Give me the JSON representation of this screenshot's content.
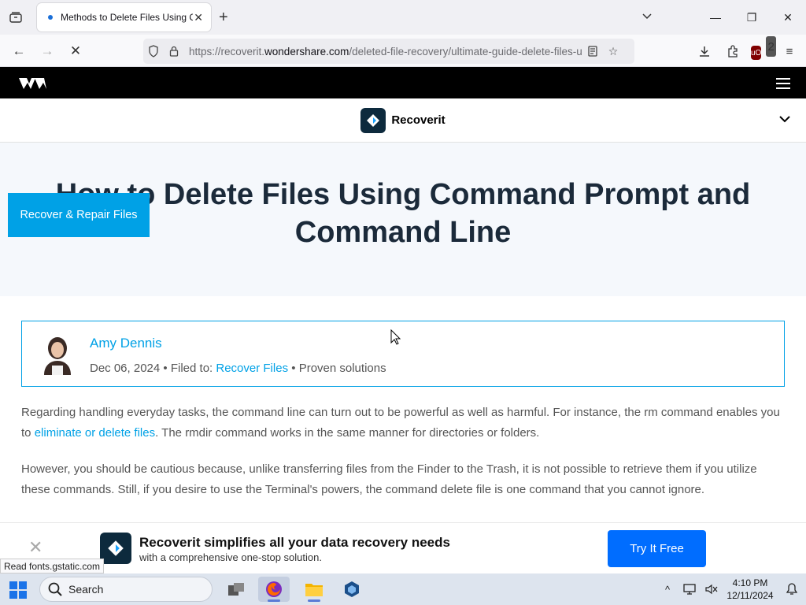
{
  "browser": {
    "tab_title": "Methods to Delete Files Using Command Prompt",
    "url_prefix": "https://recoverit.",
    "url_domain": "wondershare.com",
    "url_path": "/deleted-file-recovery/ultimate-guide-delete-files-using-cmd.html",
    "status_text": "Read fonts.gstatic.com",
    "extension_badge": "2"
  },
  "site": {
    "product_name": "Recoverit",
    "hero_title": "How to Delete Files Using Command Prompt and Command Line",
    "side_cta": "Recover & Repair Files"
  },
  "author": {
    "name": "Amy Dennis",
    "date": "Dec 06, 2024",
    "bullet": "•",
    "filed_label": "Filed to:",
    "category": "Recover Files",
    "suffix": "Proven solutions"
  },
  "article": {
    "p1_a": "Regarding handling everyday tasks, the command line can turn out to be powerful as well as harmful. For instance, the rm command enables you to",
    "p1_link": "eliminate or delete files",
    "p1_b": ". The rmdir command works in the same manner for directories or folders.",
    "p2": "However, you should be cautious because, unlike transferring files from the Finder to the Trash, it is not possible to retrieve them if you utilize these commands. Still, if you desire to use the Terminal's powers, the command delete file is one command that you cannot ignore."
  },
  "banner": {
    "title": "Recoverit simplifies all your data recovery needs",
    "subtitle": "with a comprehensive one-stop solution.",
    "button": "Try It Free"
  },
  "taskbar": {
    "search_label": "Search",
    "time": "4:10 PM",
    "date": "12/11/2024"
  },
  "colors": {
    "accent": "#00a1e6",
    "button_blue": "#006dff",
    "hero_title": "#1b2a3a"
  }
}
